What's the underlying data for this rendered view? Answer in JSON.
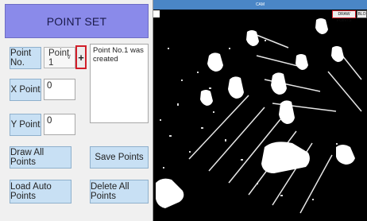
{
  "left_panel": {
    "title": "POINT SET",
    "point_no_label": "Point No.",
    "point_select_value": "Point 1",
    "add_button_label": "+",
    "x_label": "X Point",
    "x_value": "0",
    "y_label": "Y Point",
    "y_value": "0",
    "log_text": "Point No.1 was created",
    "draw_all_label": "Draw All Points",
    "save_label": "Save Points",
    "load_auto_label": "Load Auto Points",
    "delete_all_label": "Delete All Points"
  },
  "right_panel": {
    "window_title": "CAM",
    "draw_btn_label": "DRAW POINTS",
    "btn2_label": "BLO"
  }
}
